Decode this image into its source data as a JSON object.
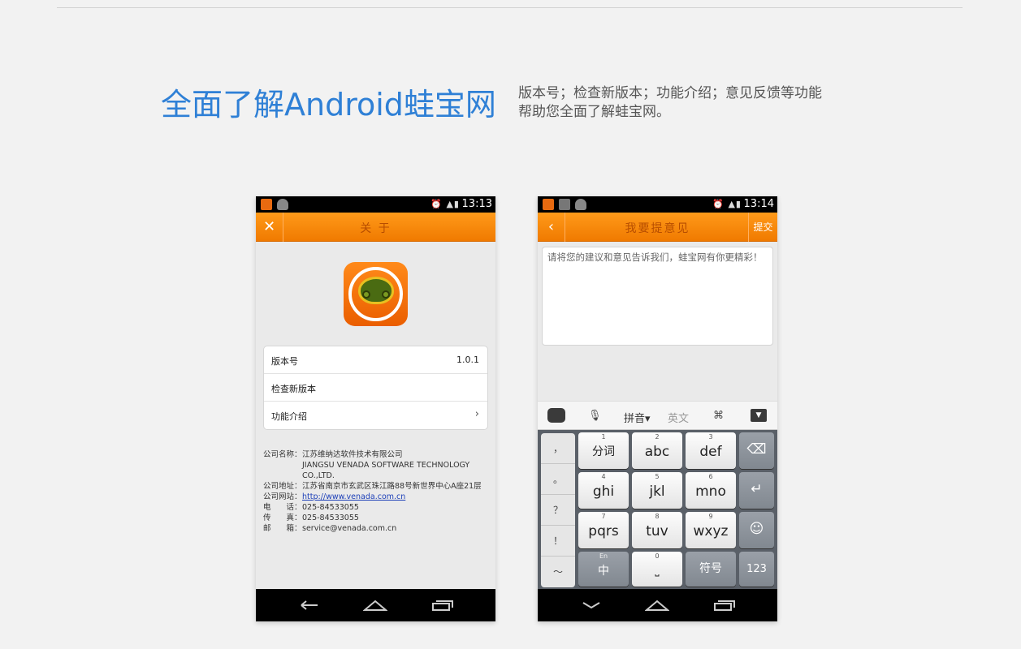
{
  "header": {
    "title": "全面了解Android蛙宝网",
    "desc_line1": "版本号；检查新版本；功能介绍；意见反馈等功能",
    "desc_line2": "帮助您全面了解蛙宝网。"
  },
  "phone1": {
    "time": "13:13",
    "title": "关 于",
    "rows": [
      {
        "label": "版本号",
        "value": "1.0.1"
      },
      {
        "label": "检查新版本",
        "value": ""
      },
      {
        "label": "功能介绍",
        "value": "›"
      }
    ],
    "company_label": "公司名称：",
    "company_cn": "江苏维纳达软件技术有限公司",
    "company_en1": "JIANGSU VENADA SOFTWARE TECHNOLOGY",
    "company_en2": "CO.,LTD.",
    "address_label": "公司地址：",
    "address": "江苏省南京市玄武区珠江路88号新世界中心A座21层",
    "site_label": "公司网站：",
    "site": "http://www.venada.com.cn",
    "phone_label": "电　　话：",
    "phone": "025-84533055",
    "fax_label": "传　　真：",
    "fax": "025-84533055",
    "email_label": "邮　　箱：",
    "email": "service@venada.com.cn"
  },
  "phone2": {
    "time": "13:14",
    "title": "我要提意见",
    "submit": "提交",
    "placeholder": "请将您的建议和意见告诉我们，蛙宝网有你更精彩！",
    "ime": {
      "pinyin": "拼音▾",
      "english": "英文"
    },
    "punct": [
      "，",
      "。",
      "？",
      "！",
      "～"
    ],
    "keys": [
      {
        "num": "1",
        "label": "分词"
      },
      {
        "num": "2",
        "label": "abc"
      },
      {
        "num": "3",
        "label": "def"
      },
      {
        "num": "4",
        "label": "ghi"
      },
      {
        "num": "5",
        "label": "jkl"
      },
      {
        "num": "6",
        "label": "mno"
      },
      {
        "num": "7",
        "label": "pqrs"
      },
      {
        "num": "8",
        "label": "tuv"
      },
      {
        "num": "9",
        "label": "wxyz"
      }
    ],
    "zh_key_sub": "En",
    "zh_key": "中",
    "zero": "0",
    "symbol": "符号",
    "num_key": "123"
  }
}
